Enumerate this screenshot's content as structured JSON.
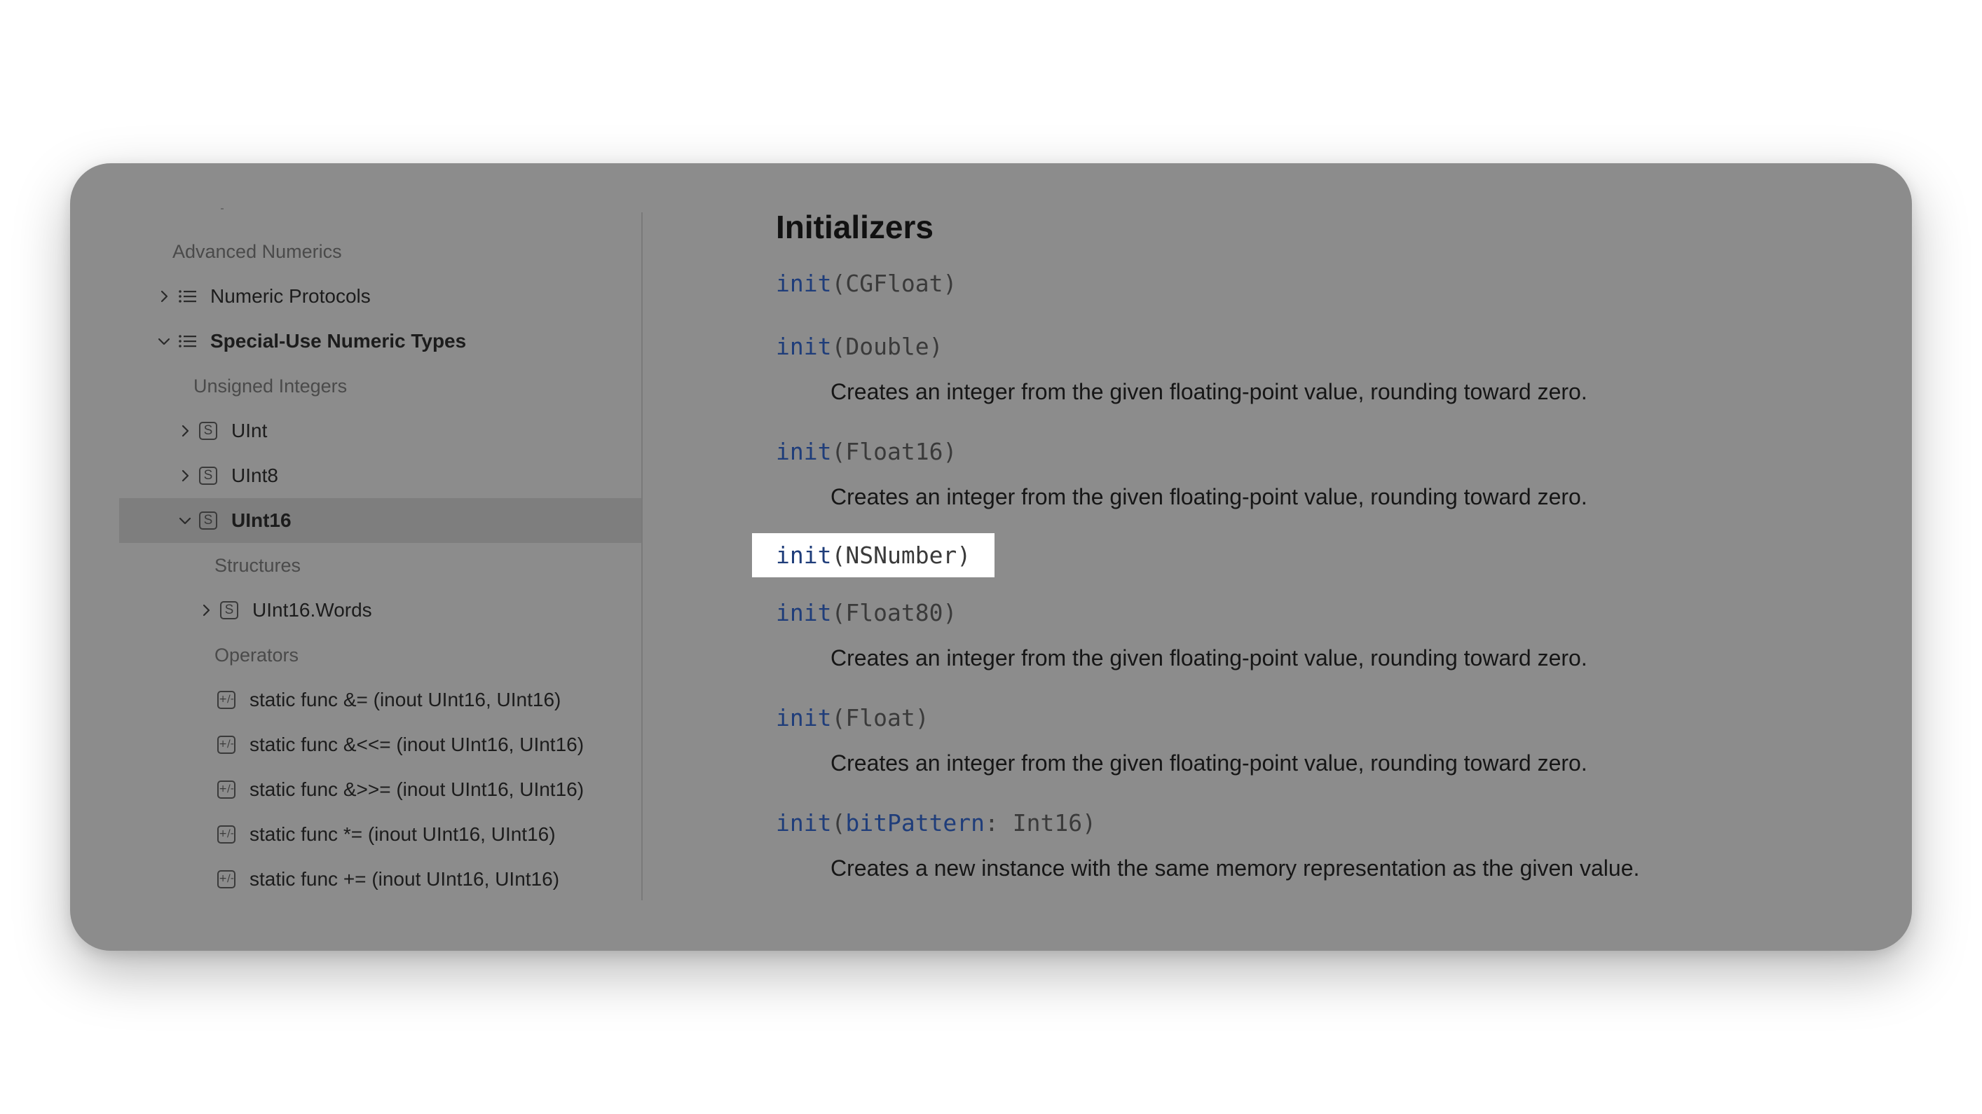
{
  "sidebar": {
    "rows": [
      {
        "label": "Advanced Numerics"
      },
      {
        "label": "Numeric Protocols"
      },
      {
        "label": "Special-Use Numeric Types"
      },
      {
        "label": "Unsigned Integers"
      },
      {
        "label": "UInt",
        "badge": "S"
      },
      {
        "label": "UInt8",
        "badge": "S"
      },
      {
        "label": "UInt16",
        "badge": "S"
      },
      {
        "label": "Structures"
      },
      {
        "label": "UInt16.Words",
        "badge": "S"
      },
      {
        "label": "Operators"
      },
      {
        "label": "static func &= (inout UInt16, UInt16)"
      },
      {
        "label": "static func &<<= (inout UInt16, UInt16)"
      },
      {
        "label": "static func &>>= (inout UInt16, UInt16)"
      },
      {
        "label": "static func *= (inout UInt16, UInt16)"
      },
      {
        "label": "static func += (inout UInt16, UInt16)"
      }
    ]
  },
  "content": {
    "title": "Initializers",
    "items": [
      {
        "kw": "init",
        "open": "(",
        "arg_label": "",
        "type": "CGFloat",
        "close": ")",
        "desc": ""
      },
      {
        "kw": "init",
        "open": "(",
        "arg_label": "",
        "type": "Double",
        "close": ")",
        "desc": "Creates an integer from the given floating-point value, rounding toward zero."
      },
      {
        "kw": "init",
        "open": "(",
        "arg_label": "",
        "type": "Float16",
        "close": ")",
        "desc": "Creates an integer from the given floating-point value, rounding toward zero."
      },
      {
        "kw": "init",
        "open": "(",
        "arg_label": "",
        "type": "NSNumber",
        "close": ")",
        "desc": ""
      },
      {
        "kw": "init",
        "open": "(",
        "arg_label": "",
        "type": "Float80",
        "close": ")",
        "desc": "Creates an integer from the given floating-point value, rounding toward zero."
      },
      {
        "kw": "init",
        "open": "(",
        "arg_label": "",
        "type": "Float",
        "close": ")",
        "desc": "Creates an integer from the given floating-point value, rounding toward zero."
      },
      {
        "kw": "init",
        "open": "(",
        "arg_label": "bitPattern",
        "colon": ": ",
        "type": "Int16",
        "close": ")",
        "desc": "Creates a new instance with the same memory representation as the given value."
      }
    ]
  },
  "icons": {
    "chevron_right": "chevron-right-icon",
    "chevron_down": "chevron-down-icon",
    "list": "list-icon",
    "structure": "structure-icon",
    "operator": "operator-icon"
  },
  "colors": {
    "keyword": "#1f3d7a",
    "overlay": "#8c8c8c",
    "highlight": "#ffffff"
  }
}
